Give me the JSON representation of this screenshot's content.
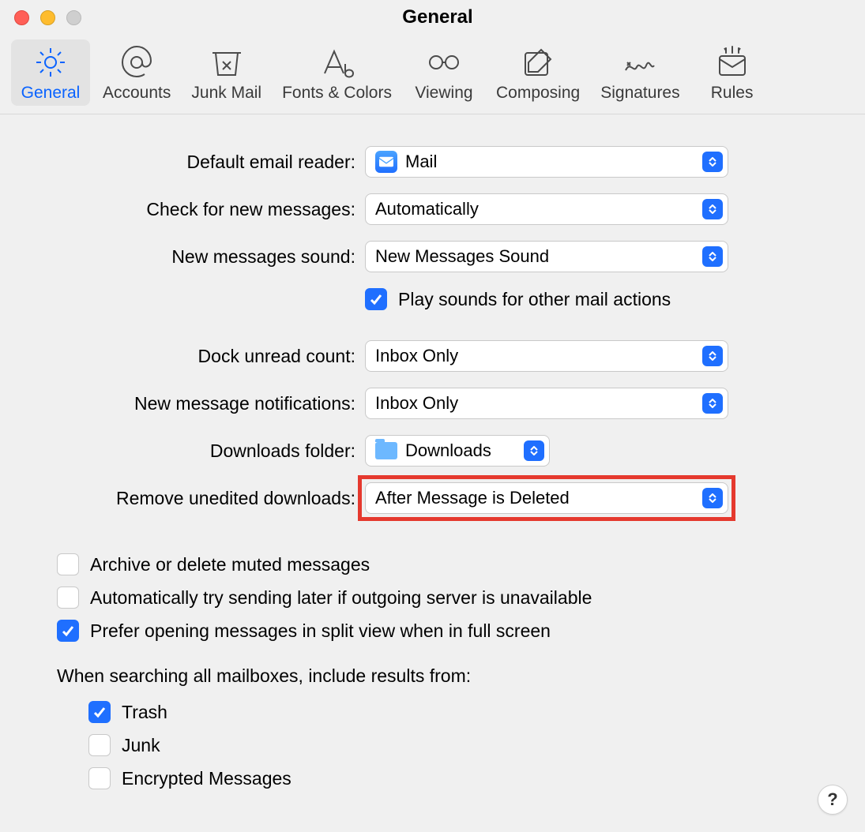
{
  "window": {
    "title": "General"
  },
  "tabs": [
    {
      "label": "General",
      "icon": "gear",
      "selected": true
    },
    {
      "label": "Accounts",
      "icon": "at",
      "selected": false
    },
    {
      "label": "Junk Mail",
      "icon": "junk",
      "selected": false
    },
    {
      "label": "Fonts & Colors",
      "icon": "fonts",
      "selected": false
    },
    {
      "label": "Viewing",
      "icon": "glasses",
      "selected": false
    },
    {
      "label": "Composing",
      "icon": "compose",
      "selected": false
    },
    {
      "label": "Signatures",
      "icon": "sig",
      "selected": false
    },
    {
      "label": "Rules",
      "icon": "rules",
      "selected": false
    }
  ],
  "form": {
    "default_reader": {
      "label": "Default email reader:",
      "value": "Mail"
    },
    "check_new": {
      "label": "Check for new messages:",
      "value": "Automatically"
    },
    "sound": {
      "label": "New messages sound:",
      "value": "New Messages Sound"
    },
    "play_sounds": {
      "label": "Play sounds for other mail actions",
      "checked": true
    },
    "dock_unread": {
      "label": "Dock unread count:",
      "value": "Inbox Only"
    },
    "notifications": {
      "label": "New message notifications:",
      "value": "Inbox Only"
    },
    "downloads_folder": {
      "label": "Downloads folder:",
      "value": "Downloads"
    },
    "remove_unedited": {
      "label": "Remove unedited downloads:",
      "value": "After Message is Deleted"
    }
  },
  "checks": {
    "archive_muted": {
      "label": "Archive or delete muted messages",
      "checked": false
    },
    "auto_retry": {
      "label": "Automatically try sending later if outgoing server is unavailable",
      "checked": false
    },
    "split_view": {
      "label": "Prefer opening messages in split view when in full screen",
      "checked": true
    }
  },
  "search": {
    "heading": "When searching all mailboxes, include results from:",
    "trash": {
      "label": "Trash",
      "checked": true
    },
    "junk": {
      "label": "Junk",
      "checked": false
    },
    "encrypted": {
      "label": "Encrypted Messages",
      "checked": false
    }
  },
  "help": "?"
}
